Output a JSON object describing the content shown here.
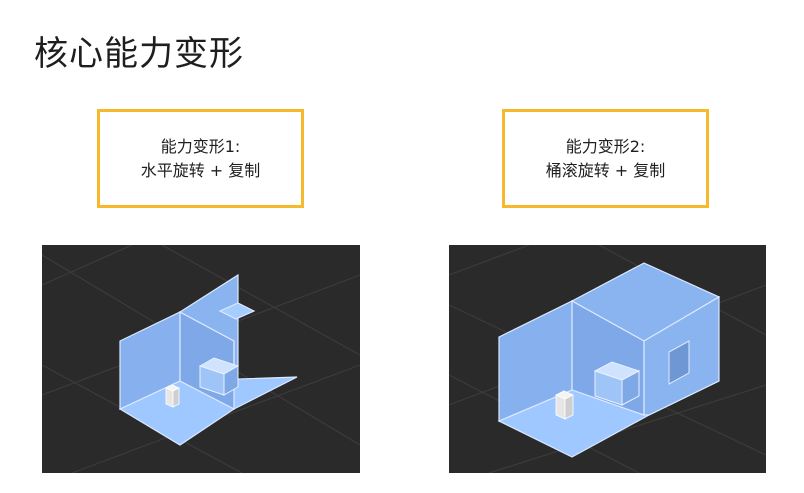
{
  "page": {
    "title": "核心能力变形"
  },
  "transforms": [
    {
      "line1": "能力变形1:",
      "line2": "水平旋转 + 复制"
    },
    {
      "line1": "能力变形2:",
      "line2": "桶滚旋转 + 复制"
    }
  ],
  "colors": {
    "accent_border": "#f7b92c",
    "scene_bg": "#2a2a2a",
    "floor": "#9ec8ff",
    "wall": "#8ab4f0",
    "wall_dark": "#7aa5e6",
    "edge": "#dce9ff",
    "grid": "#3a3a3a"
  }
}
